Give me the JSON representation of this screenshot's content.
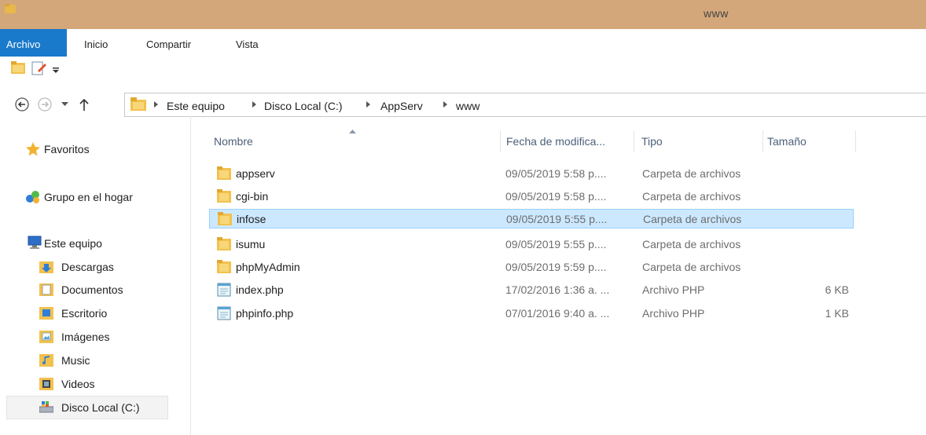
{
  "window": {
    "title": "www"
  },
  "ribbon": {
    "tabs": [
      {
        "label": "Archivo",
        "active": true
      },
      {
        "label": "Inicio"
      },
      {
        "label": "Compartir"
      },
      {
        "label": "Vista"
      }
    ],
    "quick_access": [
      "folder-icon",
      "properties-icon",
      "customize-dropdown-icon"
    ]
  },
  "address": {
    "breadcrumbs": [
      "Este equipo",
      "Disco Local (C:)",
      "AppServ",
      "www"
    ]
  },
  "sidebar": {
    "favorites": "Favoritos",
    "homegroup": "Grupo en el hogar",
    "this_pc": "Este equipo",
    "items": [
      "Descargas",
      "Documentos",
      "Escritorio",
      "Imágenes",
      "Music",
      "Videos",
      "Disco Local (C:)"
    ],
    "selected": "Disco Local (C:)"
  },
  "columns": {
    "name": "Nombre",
    "date": "Fecha de modifica...",
    "type": "Tipo",
    "size": "Tamaño",
    "sort": "Nombre ascending"
  },
  "files": [
    {
      "name": "appserv",
      "date": "09/05/2019 5:58 p....",
      "type": "Carpeta de archivos",
      "size": "",
      "icon": "folder-icon"
    },
    {
      "name": "cgi-bin",
      "date": "09/05/2019 5:58 p....",
      "type": "Carpeta de archivos",
      "size": "",
      "icon": "folder-icon"
    },
    {
      "name": "infose",
      "date": "09/05/2019 5:55 p....",
      "type": "Carpeta de archivos",
      "size": "",
      "icon": "folder-icon",
      "selected": true
    },
    {
      "name": "isumu",
      "date": "09/05/2019 5:55 p....",
      "type": "Carpeta de archivos",
      "size": "",
      "icon": "folder-icon"
    },
    {
      "name": "phpMyAdmin",
      "date": "09/05/2019 5:59 p....",
      "type": "Carpeta de archivos",
      "size": "",
      "icon": "folder-icon"
    },
    {
      "name": "index.php",
      "date": "17/02/2016 1:36 a. ...",
      "type": "Archivo PHP",
      "size": "6 KB",
      "icon": "php-file-icon"
    },
    {
      "name": "phpinfo.php",
      "date": "07/01/2016 9:40 a. ...",
      "type": "Archivo PHP",
      "size": "1 KB",
      "icon": "php-file-icon"
    }
  ],
  "colors": {
    "titlebar": "#d4a77b",
    "active_tab": "#1979ca",
    "selection": "#cce8ff",
    "selection_border": "#99d1ff"
  }
}
